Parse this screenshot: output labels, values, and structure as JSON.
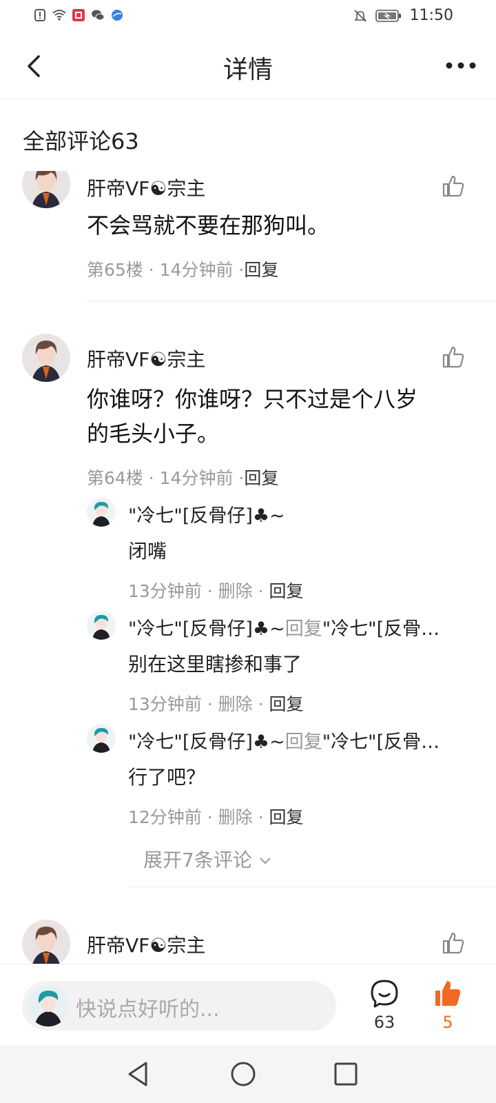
{
  "status_bar": {
    "time": "11:50",
    "icons": [
      "alert-icon",
      "wifi-icon",
      "app-notification-icon",
      "wechat-icon",
      "browser-icon",
      "mute-icon",
      "battery-icon"
    ]
  },
  "header": {
    "title": "详情",
    "back_icon": "chevron-left-icon",
    "more_icon": "more-dots-icon"
  },
  "comments_section": {
    "title": "全部评论63"
  },
  "comments": [
    {
      "name": "肝帝VF☯宗主",
      "text": "不会骂就不要在那狗叫。",
      "floor": "第65楼",
      "time": "14分钟前",
      "reply_label": "回复"
    },
    {
      "name": "肝帝VF☯宗主",
      "text_line1": "你谁呀？你谁呀？只不过是个八岁",
      "text_line2": "的毛头小子。",
      "floor": "第64楼",
      "time": "14分钟前",
      "reply_label": "回复",
      "replies": [
        {
          "name": "\"冷七\"[反骨仔]♣~",
          "reply_word": "",
          "reply_to": "",
          "text": "闭嘴",
          "time": "13分钟前",
          "delete_label": "删除",
          "reply_label": "回复"
        },
        {
          "name": "\"冷七\"[反骨仔]♣~",
          "reply_word": "回复",
          "reply_to": "\"冷七\"[反骨…",
          "text": "别在这里瞎掺和事了",
          "time": "13分钟前",
          "delete_label": "删除",
          "reply_label": "回复"
        },
        {
          "name": "\"冷七\"[反骨仔]♣~",
          "reply_word": "回复",
          "reply_to": "\"冷七\"[反骨…",
          "text": "行了吧？",
          "time": "12分钟前",
          "delete_label": "删除",
          "reply_label": "回复"
        }
      ],
      "expand_label": "展开7条评论"
    },
    {
      "name": "肝帝VF☯宗主"
    }
  ],
  "bottom_bar": {
    "input_placeholder": "快说点好听的...",
    "comment_count": "63",
    "like_count": "5",
    "accent_color": "#f06a20"
  },
  "nav_bar": {
    "icons": [
      "back-triangle-icon",
      "home-circle-icon",
      "recents-square-icon"
    ]
  }
}
